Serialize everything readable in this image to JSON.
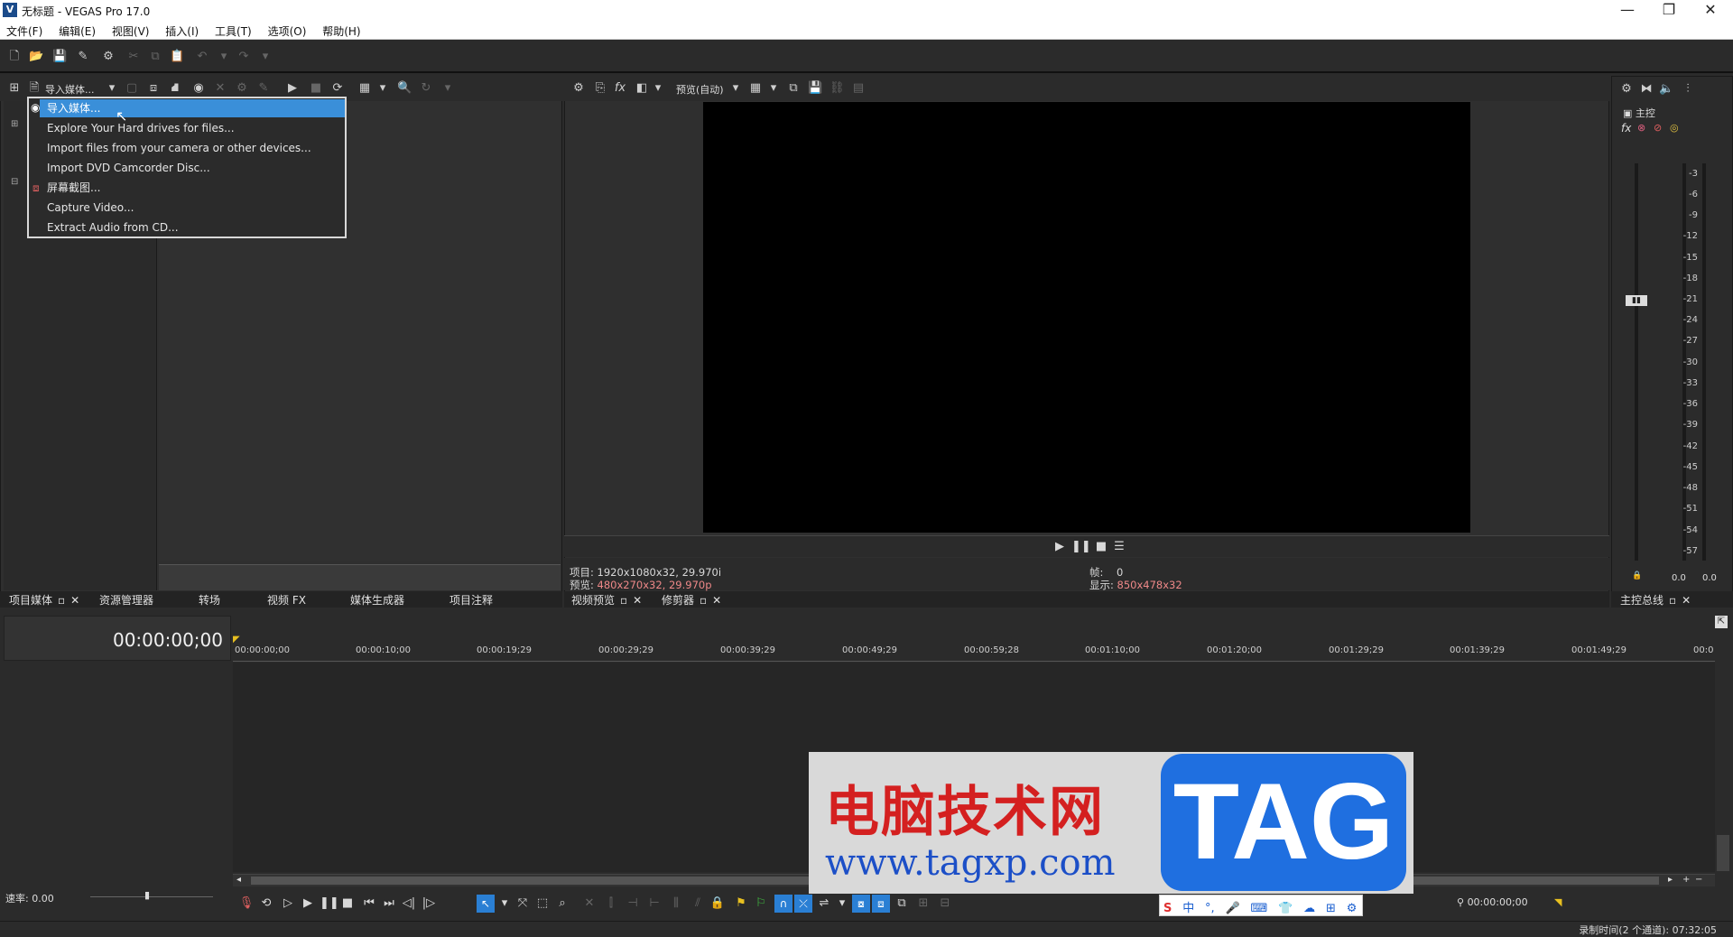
{
  "window": {
    "title": "无标题 - VEGAS Pro 17.0",
    "app_icon": "V"
  },
  "menu": [
    "文件(F)",
    "编辑(E)",
    "视图(V)",
    "插入(I)",
    "工具(T)",
    "选项(O)",
    "帮助(H)"
  ],
  "left_toolbar": {
    "import_label": "导入媒体..."
  },
  "dropdown": {
    "items": [
      "导入媒体...",
      "Explore Your Hard drives for files...",
      "Import files from your camera or other devices...",
      "Import DVD Camcorder Disc...",
      "屏幕截图...",
      "Capture Video...",
      "Extract Audio from CD..."
    ]
  },
  "left_tabs": [
    "项目媒体",
    "资源管理器",
    "转场",
    "视频 FX",
    "媒体生成器",
    "项目注释"
  ],
  "preview": {
    "quality_label": "预览(自动)",
    "project_label": "项目:",
    "project_value": "1920x1080x32, 29.970i",
    "preview_label": "预览:",
    "preview_value": "480x270x32, 29.970p",
    "frame_label": "帧:",
    "frame_value": "0",
    "display_label": "显示:",
    "display_value": "850x478x32"
  },
  "preview_tabs": [
    "视频预览",
    "修剪器"
  ],
  "master": {
    "label": "主控",
    "ticks": [
      "-3",
      "-6",
      "-9",
      "-12",
      "-15",
      "-18",
      "-21",
      "-24",
      "-27",
      "-30",
      "-33",
      "-36",
      "-39",
      "-42",
      "-45",
      "-48",
      "-51",
      "-54",
      "-57"
    ],
    "level_left": "0.0",
    "level_right": "0.0",
    "tab": "主控总线"
  },
  "timeline": {
    "time": "00:00:00;00",
    "ruler": [
      "00:00:00;00",
      "00:00:10;00",
      "00:00:19;29",
      "00:00:29;29",
      "00:00:39;29",
      "00:00:49;29",
      "00:00:59;28",
      "00:01:10;00",
      "00:01:20;00",
      "00:01:29;29",
      "00:01:39;29",
      "00:01:49;29",
      "00:0"
    ],
    "rate": "速率: 0.00",
    "cursor_time": "00:00:00;00"
  },
  "status": {
    "record_time": "录制时间(2 个通道): 07:32:05"
  },
  "watermark": {
    "cn": "电脑技术网",
    "url": "www.tagxp.com",
    "tag": "TAG"
  },
  "ime": [
    "中",
    "°,",
    "🎤",
    "⌨",
    "👕",
    "☁",
    "⊞",
    "⚙"
  ],
  "ime_logo": "S"
}
